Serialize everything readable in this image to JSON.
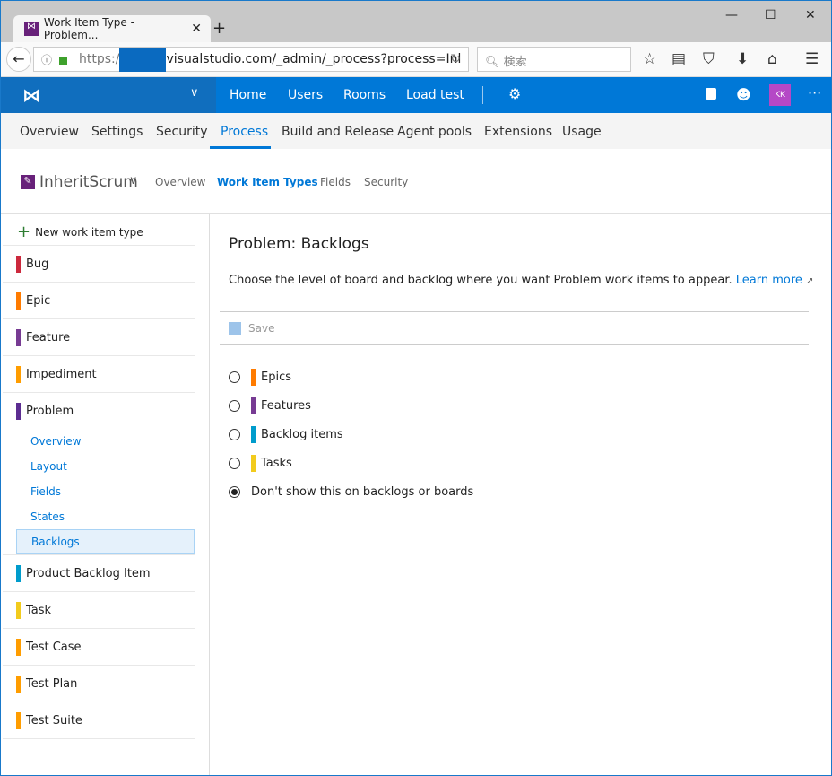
{
  "browser": {
    "tab_title": "Work Item Type - Problem...",
    "url_prefix": "https:/",
    "url_rest": "visualstudio.com/_admin/_process?process=Inl",
    "search_placeholder": "検索"
  },
  "topnav": {
    "items": [
      "Home",
      "Users",
      "Rooms",
      "Load test"
    ],
    "avatar": "KK",
    "colors": {
      "bar": "#0078d7",
      "avatar": "#b548c6"
    }
  },
  "subnav": {
    "items": [
      "Overview",
      "Settings",
      "Security",
      "Process",
      "Build and Release",
      "Agent pools",
      "Extensions",
      "Usage"
    ],
    "active": "Process"
  },
  "process": {
    "name": "InheritScrum",
    "tabs": [
      "Overview",
      "Work Item Types",
      "Fields",
      "Security"
    ],
    "active": "Work Item Types"
  },
  "sidebar": {
    "new_label": "New work item type",
    "items": [
      {
        "label": "Bug",
        "color": "#cc293d"
      },
      {
        "label": "Epic",
        "color": "#ff7b00"
      },
      {
        "label": "Feature",
        "color": "#773b93"
      },
      {
        "label": "Impediment",
        "color": "#ff9d00"
      },
      {
        "label": "Problem",
        "color": "#5c2d91"
      },
      {
        "label": "Product Backlog Item",
        "color": "#009ccc"
      },
      {
        "label": "Task",
        "color": "#f2cb1d"
      },
      {
        "label": "Test Case",
        "color": "#ff9d00"
      },
      {
        "label": "Test Plan",
        "color": "#ff9d00"
      },
      {
        "label": "Test Suite",
        "color": "#ff9d00"
      }
    ],
    "sub_items": [
      "Overview",
      "Layout",
      "Fields",
      "States",
      "Backlogs"
    ],
    "selected_sub": "Backlogs"
  },
  "main": {
    "title": "Problem: Backlogs",
    "description": "Choose the level of board and backlog where you want Problem work items to appear.",
    "learn_more": "Learn more",
    "save": "Save",
    "options": [
      {
        "label": "Epics",
        "color": "#ff7b00",
        "checked": false
      },
      {
        "label": "Features",
        "color": "#773b93",
        "checked": false
      },
      {
        "label": "Backlog items",
        "color": "#009ccc",
        "checked": false
      },
      {
        "label": "Tasks",
        "color": "#f2cb1d",
        "checked": false
      },
      {
        "label": "Don't show this on backlogs or boards",
        "color": null,
        "checked": true
      }
    ]
  }
}
